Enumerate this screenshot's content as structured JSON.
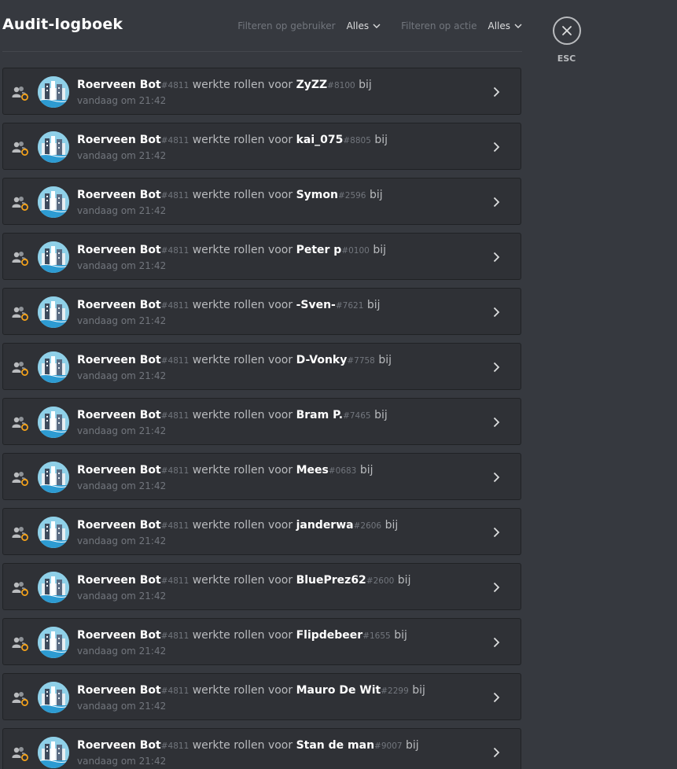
{
  "header": {
    "title": "Audit-logboek",
    "filter_user_label": "Filteren op gebruiker",
    "filter_user_value": "Alles",
    "filter_action_label": "Filteren op actie",
    "filter_action_value": "Alles"
  },
  "close": {
    "label": "ESC"
  },
  "colors": {
    "background": "#36393f",
    "entry_background": "#2f3136",
    "action_icon_accent": "#faa61a"
  },
  "entries": [
    {
      "actor": "Roerveen Bot",
      "actor_tag": "#4811",
      "action": "werkte rollen voor",
      "target": "ZyZZ",
      "target_tag": "#8100",
      "suffix": "bij",
      "time": "vandaag om 21:42"
    },
    {
      "actor": "Roerveen Bot",
      "actor_tag": "#4811",
      "action": "werkte rollen voor",
      "target": "kai_075",
      "target_tag": "#8805",
      "suffix": "bij",
      "time": "vandaag om 21:42"
    },
    {
      "actor": "Roerveen Bot",
      "actor_tag": "#4811",
      "action": "werkte rollen voor",
      "target": "Symon",
      "target_tag": "#2596",
      "suffix": "bij",
      "time": "vandaag om 21:42"
    },
    {
      "actor": "Roerveen Bot",
      "actor_tag": "#4811",
      "action": "werkte rollen voor",
      "target": "Peter p",
      "target_tag": "#0100",
      "suffix": "bij",
      "time": "vandaag om 21:42"
    },
    {
      "actor": "Roerveen Bot",
      "actor_tag": "#4811",
      "action": "werkte rollen voor",
      "target": "-Sven-",
      "target_tag": "#7621",
      "suffix": "bij",
      "time": "vandaag om 21:42"
    },
    {
      "actor": "Roerveen Bot",
      "actor_tag": "#4811",
      "action": "werkte rollen voor",
      "target": "D-Vonky",
      "target_tag": "#7758",
      "suffix": "bij",
      "time": "vandaag om 21:42"
    },
    {
      "actor": "Roerveen Bot",
      "actor_tag": "#4811",
      "action": "werkte rollen voor",
      "target": "Bram P.",
      "target_tag": "#7465",
      "suffix": "bij",
      "time": "vandaag om 21:42"
    },
    {
      "actor": "Roerveen Bot",
      "actor_tag": "#4811",
      "action": "werkte rollen voor",
      "target": "Mees",
      "target_tag": "#0683",
      "suffix": "bij",
      "time": "vandaag om 21:42"
    },
    {
      "actor": "Roerveen Bot",
      "actor_tag": "#4811",
      "action": "werkte rollen voor",
      "target": "janderwa",
      "target_tag": "#2606",
      "suffix": "bij",
      "time": "vandaag om 21:42"
    },
    {
      "actor": "Roerveen Bot",
      "actor_tag": "#4811",
      "action": "werkte rollen voor",
      "target": "BluePrez62",
      "target_tag": "#2600",
      "suffix": "bij",
      "time": "vandaag om 21:42"
    },
    {
      "actor": "Roerveen Bot",
      "actor_tag": "#4811",
      "action": "werkte rollen voor",
      "target": "Flipdebeer",
      "target_tag": "#1655",
      "suffix": "bij",
      "time": "vandaag om 21:42"
    },
    {
      "actor": "Roerveen Bot",
      "actor_tag": "#4811",
      "action": "werkte rollen voor",
      "target": "Mauro De Wit",
      "target_tag": "#2299",
      "suffix": "bij",
      "time": "vandaag om 21:42"
    },
    {
      "actor": "Roerveen Bot",
      "actor_tag": "#4811",
      "action": "werkte rollen voor",
      "target": "Stan de man",
      "target_tag": "#9007",
      "suffix": "bij",
      "time": "vandaag om 21:42"
    }
  ]
}
